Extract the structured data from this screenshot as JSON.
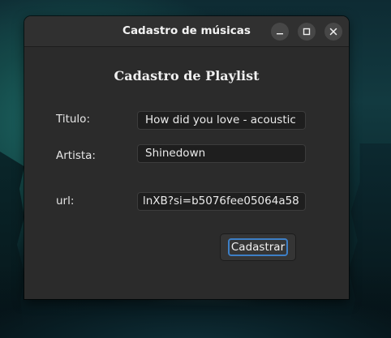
{
  "window": {
    "title": "Cadastro de músicas",
    "controls": {
      "minimize_icon": "minimize-icon",
      "maximize_icon": "maximize-icon",
      "close_icon": "close-icon"
    }
  },
  "form": {
    "heading": "Cadastro de Playlist",
    "fields": {
      "titulo": {
        "label": "Titulo:",
        "value": "How did you love - acoustic"
      },
      "artista": {
        "label": "Artista:",
        "value": "Shinedown"
      },
      "url": {
        "label": "url:",
        "value": "lnXB?si=b5076fee05064a58"
      }
    },
    "submit_label": "Cadastrar"
  },
  "colors": {
    "window_bg": "#2b2b2b",
    "titlebar_bg": "#303030",
    "input_bg": "#1e1e1e",
    "focus_accent": "#3d7fc6"
  }
}
